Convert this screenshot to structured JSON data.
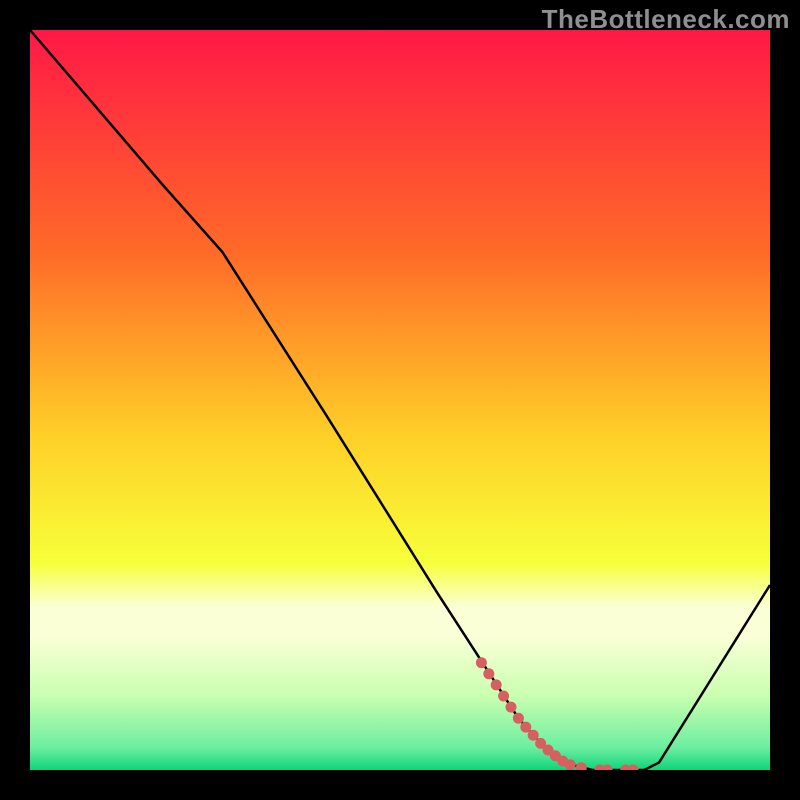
{
  "watermark": "TheBottleneck.com",
  "colors": {
    "background": "#000000",
    "watermark_text": "#8f8f8f",
    "curve": "#000000",
    "dots": "#d66060",
    "gradient_top": "#ff1846",
    "gradient_mid1": "#ff6a28",
    "gradient_mid2": "#ffd028",
    "gradient_mid3": "#f7ff3a",
    "gradient_bottom_band_top": "#fbffd6",
    "gradient_bottom": "#0fd47a"
  },
  "chart_data": {
    "type": "line",
    "title": "",
    "xlabel": "",
    "ylabel": "",
    "xlim": [
      0,
      100
    ],
    "ylim": [
      0,
      100
    ],
    "series": [
      {
        "name": "bottleneck-curve",
        "x": [
          0,
          18,
          26,
          40,
          55,
          66,
          70,
          72,
          76,
          78,
          80,
          83,
          85,
          100
        ],
        "y": [
          100,
          79,
          70,
          48,
          24,
          7,
          2.5,
          1,
          0,
          0,
          0,
          0,
          1,
          25
        ]
      }
    ],
    "annotations": [
      {
        "name": "optimal-range-dots",
        "style": "dots",
        "points": [
          {
            "x": 61,
            "y": 14.5
          },
          {
            "x": 62,
            "y": 13
          },
          {
            "x": 63,
            "y": 11.5
          },
          {
            "x": 64,
            "y": 10
          },
          {
            "x": 65,
            "y": 8.5
          },
          {
            "x": 66,
            "y": 7
          },
          {
            "x": 67,
            "y": 5.8
          },
          {
            "x": 68,
            "y": 4.7
          },
          {
            "x": 69,
            "y": 3.6
          },
          {
            "x": 70,
            "y": 2.7
          },
          {
            "x": 71,
            "y": 1.9
          },
          {
            "x": 72,
            "y": 1.2
          },
          {
            "x": 73,
            "y": 0.7
          },
          {
            "x": 74.5,
            "y": 0.3
          },
          {
            "x": 77,
            "y": 0
          },
          {
            "x": 78,
            "y": 0
          },
          {
            "x": 80.5,
            "y": 0
          },
          {
            "x": 81.5,
            "y": 0
          }
        ]
      }
    ],
    "background": {
      "type": "vertical-gradient",
      "stops": [
        {
          "offset": 0.0,
          "color": "#ff1846"
        },
        {
          "offset": 0.3,
          "color": "#ff6a28"
        },
        {
          "offset": 0.55,
          "color": "#ffd028"
        },
        {
          "offset": 0.72,
          "color": "#f7ff3a"
        },
        {
          "offset": 0.78,
          "color": "#fbffd6"
        },
        {
          "offset": 0.82,
          "color": "#fbffd6"
        },
        {
          "offset": 0.9,
          "color": "#c9ffb0"
        },
        {
          "offset": 0.97,
          "color": "#6beea0"
        },
        {
          "offset": 1.0,
          "color": "#0fd47a"
        }
      ]
    }
  }
}
